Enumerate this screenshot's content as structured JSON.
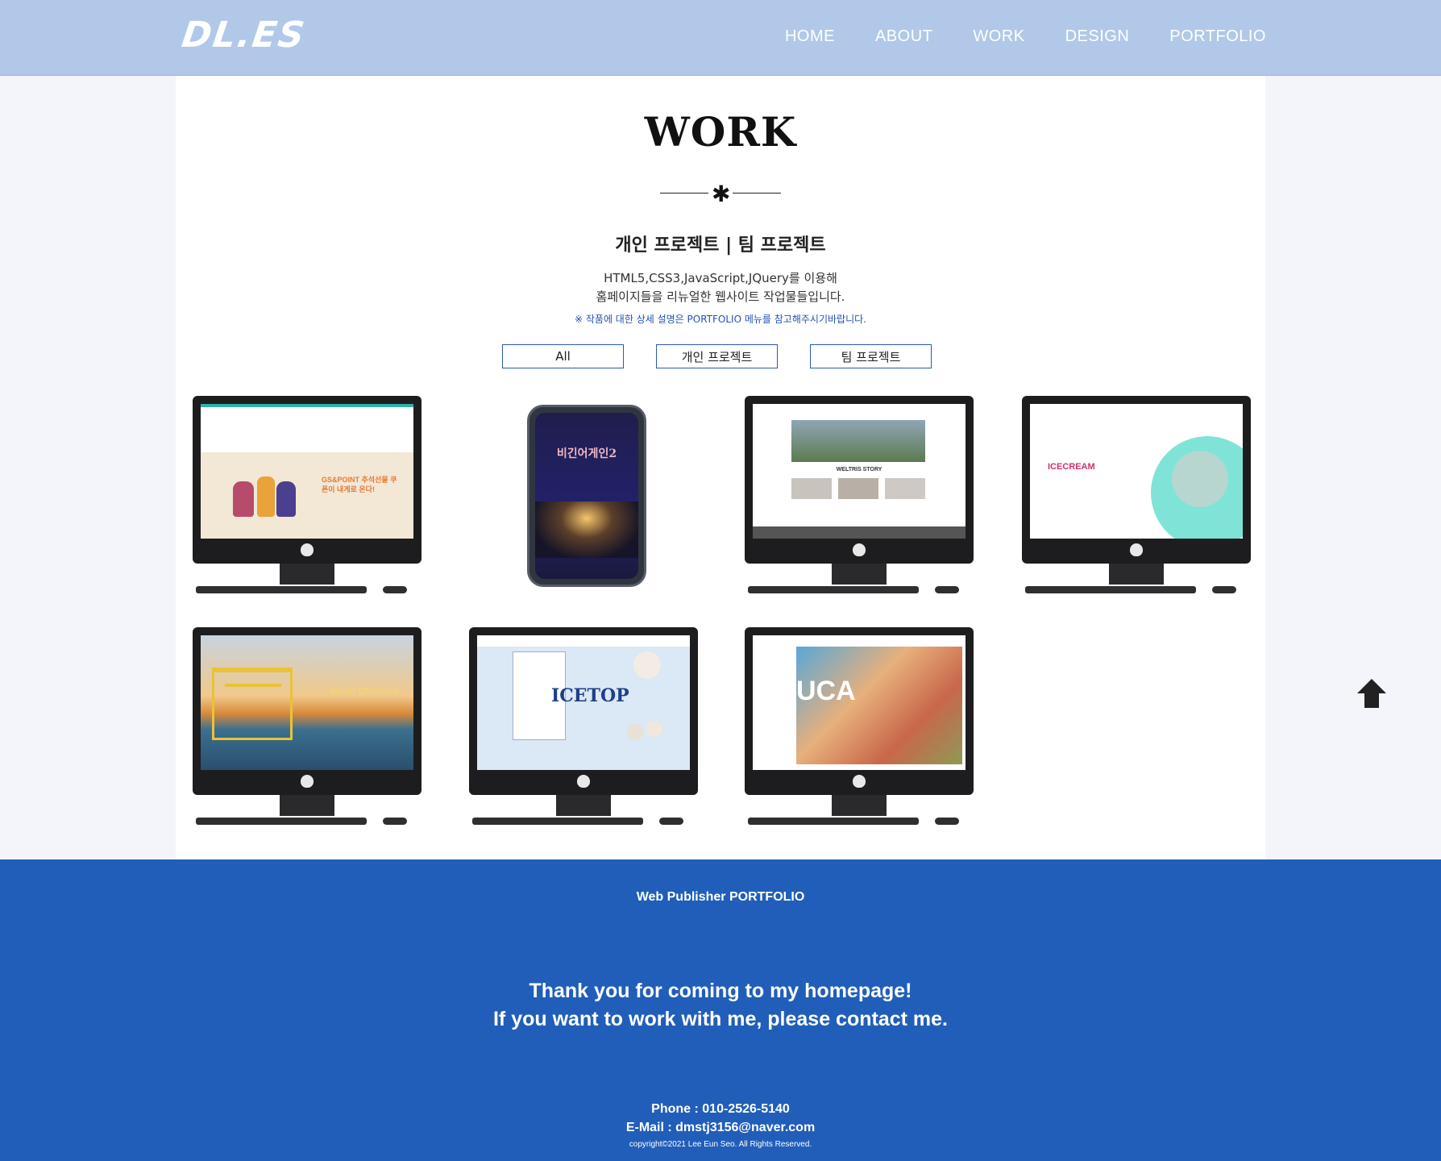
{
  "header": {
    "logo": "DL.ES",
    "nav": [
      "HOME",
      "ABOUT",
      "WORK",
      "DESIGN",
      "PORTFOLIO"
    ]
  },
  "work": {
    "title": "WORK",
    "subtitle": "개인 프로젝트 | 팀 프로젝트",
    "desc_line1": "HTML5,CSS3,JavaScript,JQuery를 이용해",
    "desc_line2": "홈페이지들을 리뉴얼한 웹사이트 작업물들입니다.",
    "note": "※ 작품에 대한 상세 설명은 PORTFOLIO 메뉴를 참고해주시기바랍니다.",
    "filters": [
      "All",
      "개인 프로젝트",
      "팀 프로젝트"
    ]
  },
  "projects": [
    {
      "label": "GS&POINT 추석선물 쿠폰이 내게로 온다!",
      "device": "imac",
      "theme": "#f3e7d6"
    },
    {
      "label": "비긴어게인2",
      "device": "phone",
      "theme": "#222169"
    },
    {
      "label": "WELTRIS STORY",
      "device": "imac",
      "theme": "#ffffff"
    },
    {
      "label": "ICECREAM",
      "device": "imac",
      "theme": "#ffffff"
    },
    {
      "label": "Marin Offshore",
      "device": "imac",
      "theme": "#d9a04a"
    },
    {
      "label": "ICETOP",
      "device": "imac",
      "theme": "#dbe8f5"
    },
    {
      "label": "UCA",
      "device": "imac",
      "theme": "#5aa7d8"
    }
  ],
  "footer": {
    "title": "Web Publisher PORTFOLIO",
    "thanks1": "Thank you for coming to my homepage!",
    "thanks2": "If you want to work with me, please contact me.",
    "phone": "Phone : 010-2526-5140",
    "email": "E-Mail : dmstj3156@naver.com",
    "copyright": "copyright©2021 Lee Eun Seo. All Rights Reserved."
  },
  "colors": {
    "header_bg": "#b1c8e8",
    "footer_bg": "#215eb9",
    "accent": "#2c57b5"
  },
  "icons": [
    "arrow-up-icon",
    "apple-logo-icon"
  ]
}
